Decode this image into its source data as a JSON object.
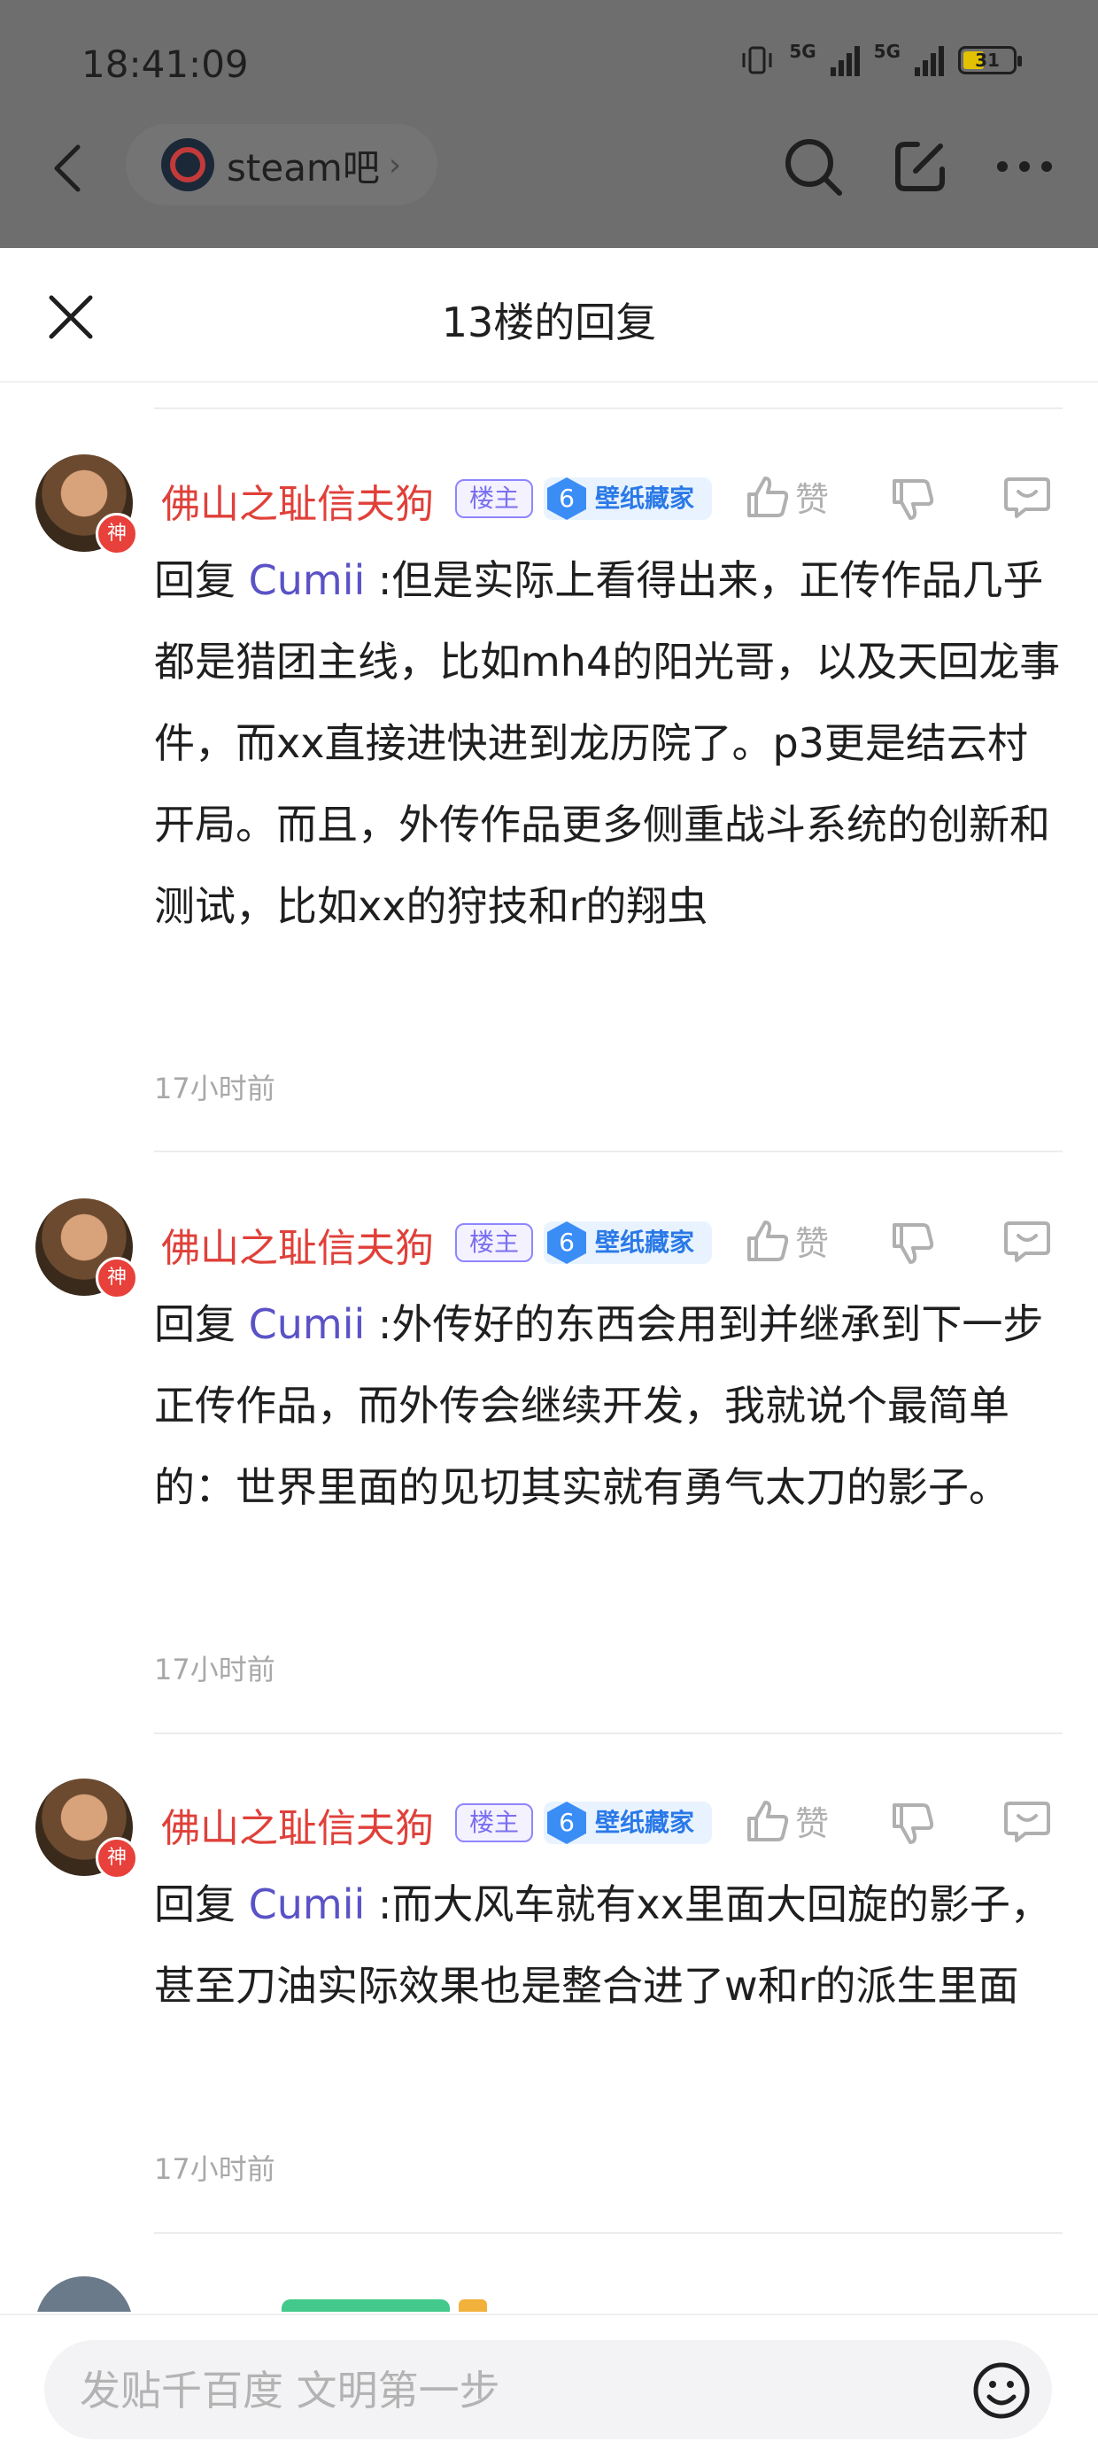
{
  "status_bar": {
    "time": "18:41:09",
    "network_1": "5G",
    "network_2": "5G",
    "battery": "31"
  },
  "nav": {
    "forum_name": "steam吧",
    "forum_chevron": "›"
  },
  "sheet": {
    "title": "13楼的回复"
  },
  "comments": [
    {
      "username": "佛山之耻信夫狗",
      "avatar_badge": "神",
      "owner_badge": "楼主",
      "level": "6",
      "level_title": "壁纸藏家",
      "like_label": "赞",
      "reply_prefix": "回复 ",
      "mention": "Cumii",
      "text": " :但是实际上看得出来，正传作品几乎都是猎团主线，比如mh4的阳光哥，以及天回龙事件，而xx直接进快进到龙历院了。p3更是结云村开局。而且，外传作品更多侧重战斗系统的创新和测试，比如xx的狩技和r的翔虫",
      "time": "17小时前"
    },
    {
      "username": "佛山之耻信夫狗",
      "avatar_badge": "神",
      "owner_badge": "楼主",
      "level": "6",
      "level_title": "壁纸藏家",
      "like_label": "赞",
      "reply_prefix": "回复 ",
      "mention": "Cumii",
      "text": " :外传好的东西会用到并继承到下一步正传作品，而外传会继续开发，我就说个最简单的：世界里面的见切其实就有勇气太刀的影子。",
      "time": "17小时前"
    },
    {
      "username": "佛山之耻信夫狗",
      "avatar_badge": "神",
      "owner_badge": "楼主",
      "level": "6",
      "level_title": "壁纸藏家",
      "like_label": "赞",
      "reply_prefix": "回复 ",
      "mention": "Cumii",
      "text": " :而大风车就有xx里面大回旋的影子，甚至刀油实际效果也是整合进了w和r的派生里面",
      "time": "17小时前"
    }
  ],
  "composer": {
    "placeholder": "发贴千百度 文明第一步"
  },
  "colors": {
    "username": "#e0403a",
    "mention": "#5a52c6",
    "owner_badge": "#7a6ff0",
    "level_badge": "#3b8df6"
  }
}
